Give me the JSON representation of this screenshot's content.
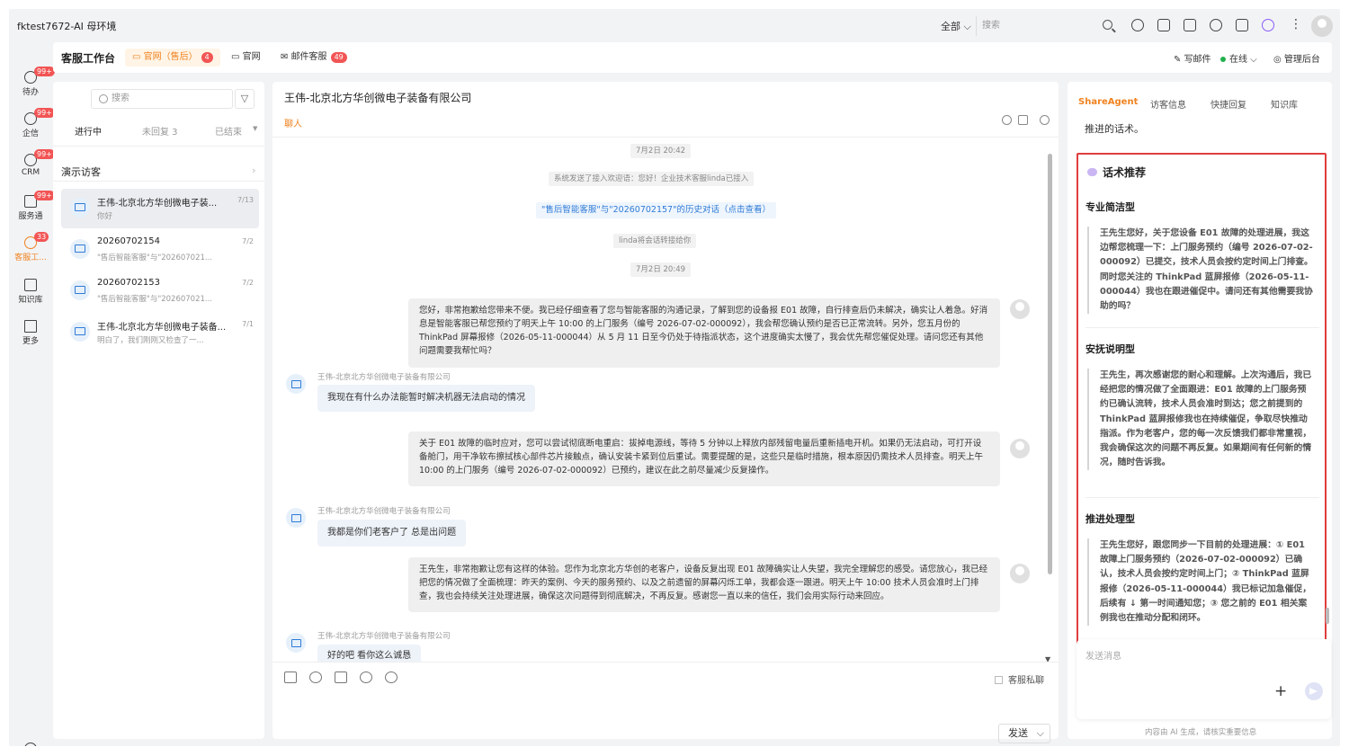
{
  "topbar": {
    "env_title": "fktest7672-AI 母环境",
    "scope_select": "全部",
    "search_placeholder": "搜索"
  },
  "leftnav": [
    {
      "label": "待办",
      "badge": "99+",
      "icon": "todo-icon"
    },
    {
      "label": "企信",
      "badge": "99+",
      "icon": "chat-icon"
    },
    {
      "label": "CRM",
      "badge": "99+",
      "icon": "crm-icon"
    },
    {
      "label": "服务通",
      "badge": "99+",
      "icon": "service-icon"
    },
    {
      "label": "客服工...",
      "badge": "33",
      "icon": "headset-icon"
    },
    {
      "label": "知识库",
      "badge": "",
      "icon": "book-icon"
    },
    {
      "label": "更多",
      "badge": "",
      "icon": "grid-icon"
    }
  ],
  "tabsbar": {
    "title": "客服工作台",
    "tabs": [
      {
        "label": "官网（售后）",
        "badge": "4"
      },
      {
        "label": "官网",
        "badge": ""
      },
      {
        "label": "邮件客服",
        "badge": "49"
      }
    ],
    "write_mail": "写邮件",
    "status": "在线",
    "admin": "管理后台"
  },
  "list": {
    "search_placeholder": "搜索",
    "filter_icon": "filter-icon",
    "tabs": [
      "进行中",
      "未回复 3",
      "已结束"
    ],
    "demo_label": "演示访客",
    "conversations": [
      {
        "name": "王伟-北京北方华创微电子装...",
        "date": "7/13",
        "preview": "你好"
      },
      {
        "name": "20260702154",
        "date": "7/2",
        "preview": "\"售后智能客服\"与\"202607021..."
      },
      {
        "name": "20260702153",
        "date": "7/2",
        "preview": "\"售后智能客服\"与\"202607021..."
      },
      {
        "name": "王伟-北京北方华创微电子装备...",
        "date": "7/1",
        "preview": "明白了，我们刚刚又检查了一..."
      }
    ]
  },
  "chat": {
    "title": "王伟-北京北方华创微电子装备有限公司",
    "subtab": "聊人",
    "ts1": "7月2日 20:42",
    "sys1": "系统发送了接入欢迎语：您好！企业技术客服linda已接入",
    "history_link": "\"售后智能客服\"与\"20260702157\"的历史对话（点击查看）",
    "transfer": "linda将会话转接给你",
    "ts2": "7月2日 20:49",
    "msg1": "您好，非常抱歉给您带来不便。我已经仔细查看了您与智能客服的沟通记录，了解到您的设备报 E01 故障，自行排查后仍未解决，确实让人着急。好消息是智能客服已帮您预约了明天上午 10:00 的上门服务（编号 2026-07-02-000092），我会帮您确认预约是否已正常流转。另外，您五月份的 ThinkPad 屏幕报修（2026-05-11-000044）从 5 月 11 日至今仍处于待指派状态，这个进度确实太慢了，我会优先帮您催促处理。请问您还有其他问题需要我帮忙吗？",
    "customer_name": "王伟-北京北方华创微电子装备有限公司",
    "msg2": "我现在有什么办法能暂时解决机器无法启动的情况",
    "msg3": "关于 E01 故障的临时应对，您可以尝试彻底断电重启：拔掉电源线，等待 5 分钟以上释放内部残留电量后重新插电开机。如果仍无法启动，可打开设备舱门，用干净软布擦拭核心部件芯片接触点，确认安装卡紧到位后重试。需要提醒的是，这些只是临时措施，根本原因仍需技术人员排查。明天上午 10:00 的上门服务（编号 2026-07-02-000092）已预约，建议在此之前尽量减少反复操作。",
    "msg4": "我都是你们老客户了 总是出问题",
    "msg5": "王先生，非常抱歉让您有这样的体验。您作为北京北方华创的老客户，设备反复出现 E01 故障确实让人失望，我完全理解您的感受。请您放心，我已经把您的情况做了全面梳理：昨天的案例、今天的服务预约、以及之前遗留的屏幕闪烁工单，我都会逐一跟进。明天上午 10:00 技术人员会准时上门排查，我也会持续关注处理进展，确保这次问题得到彻底解决，不再反复。感谢您一直以来的信任，我们会用实际行动来回应。",
    "msg6": "好的吧 看你这么诚恳",
    "private_label": "客服私聊",
    "send_label": "发送"
  },
  "right": {
    "tabs": [
      "ShareAgent",
      "访客信息",
      "快捷回复",
      "知识库"
    ],
    "intro_text": "推进的话术。",
    "rec_title": "话术推荐",
    "sections": [
      {
        "heading": "专业简洁型",
        "text": "王先生您好，关于您设备 E01 故障的处理进展，我这边帮您梳理一下：上门服务预约（编号 2026-07-02-000092）已提交，技术人员会按约定时间上门排查。同时您关注的 ThinkPad 蓝屏报修（2026-05-11-000044）我也在跟进催促中。请问还有其他需要我协助的吗？"
      },
      {
        "heading": "安抚说明型",
        "text": "王先生，再次感谢您的耐心和理解。上次沟通后，我已经把您的情况做了全面跟进：E01 故障的上门服务预约已确认流转，技术人员会准时到达；您之前提到的 ThinkPad 蓝屏报修我也在持续催促，争取尽快推动指派。作为老客户，您的每一次反馈我们都非常重视，我会确保这次的问题不再反复。如果期间有任何新的情况，随时告诉我。"
      },
      {
        "heading": "推进处理型",
        "text": "王先生您好，跟您同步一下目前的处理进展：① E01 故障上门服务预约（2026-07-02-000092）已确认，技术人员会按约定时间上门；② ThinkPad 蓝屏报修（2026-05-11-000044）我已标记加急催促，后续有 ↓ 第一时间通知您；③ 您之前的 E01 相关案例我也在推动分配和闭环。"
      }
    ],
    "input_placeholder": "发送消息",
    "disclaimer": "内容由 AI 生成，请核实重要信息"
  },
  "colors": {
    "accent": "#f0821e",
    "link": "#2f7bd6",
    "badge": "#f25555",
    "highlight_border": "#e03d3d",
    "online": "#22b14c"
  }
}
